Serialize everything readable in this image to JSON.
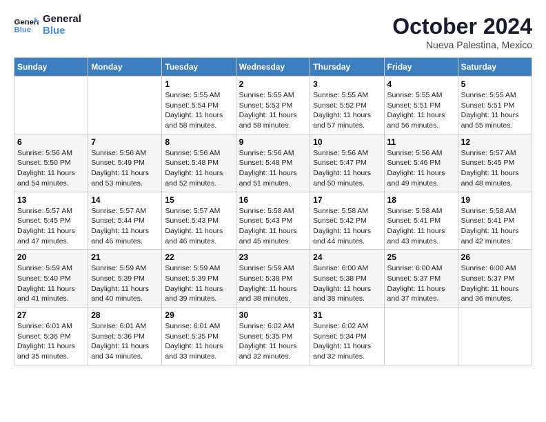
{
  "header": {
    "logo_text_general": "General",
    "logo_text_blue": "Blue",
    "month_title": "October 2024",
    "location": "Nueva Palestina, Mexico"
  },
  "weekdays": [
    "Sunday",
    "Monday",
    "Tuesday",
    "Wednesday",
    "Thursday",
    "Friday",
    "Saturday"
  ],
  "weeks": [
    [
      {
        "day": "",
        "info": ""
      },
      {
        "day": "",
        "info": ""
      },
      {
        "day": "1",
        "info": "Sunrise: 5:55 AM\nSunset: 5:54 PM\nDaylight: 11 hours and 58 minutes."
      },
      {
        "day": "2",
        "info": "Sunrise: 5:55 AM\nSunset: 5:53 PM\nDaylight: 11 hours and 58 minutes."
      },
      {
        "day": "3",
        "info": "Sunrise: 5:55 AM\nSunset: 5:52 PM\nDaylight: 11 hours and 57 minutes."
      },
      {
        "day": "4",
        "info": "Sunrise: 5:55 AM\nSunset: 5:51 PM\nDaylight: 11 hours and 56 minutes."
      },
      {
        "day": "5",
        "info": "Sunrise: 5:55 AM\nSunset: 5:51 PM\nDaylight: 11 hours and 55 minutes."
      }
    ],
    [
      {
        "day": "6",
        "info": "Sunrise: 5:56 AM\nSunset: 5:50 PM\nDaylight: 11 hours and 54 minutes."
      },
      {
        "day": "7",
        "info": "Sunrise: 5:56 AM\nSunset: 5:49 PM\nDaylight: 11 hours and 53 minutes."
      },
      {
        "day": "8",
        "info": "Sunrise: 5:56 AM\nSunset: 5:48 PM\nDaylight: 11 hours and 52 minutes."
      },
      {
        "day": "9",
        "info": "Sunrise: 5:56 AM\nSunset: 5:48 PM\nDaylight: 11 hours and 51 minutes."
      },
      {
        "day": "10",
        "info": "Sunrise: 5:56 AM\nSunset: 5:47 PM\nDaylight: 11 hours and 50 minutes."
      },
      {
        "day": "11",
        "info": "Sunrise: 5:56 AM\nSunset: 5:46 PM\nDaylight: 11 hours and 49 minutes."
      },
      {
        "day": "12",
        "info": "Sunrise: 5:57 AM\nSunset: 5:45 PM\nDaylight: 11 hours and 48 minutes."
      }
    ],
    [
      {
        "day": "13",
        "info": "Sunrise: 5:57 AM\nSunset: 5:45 PM\nDaylight: 11 hours and 47 minutes."
      },
      {
        "day": "14",
        "info": "Sunrise: 5:57 AM\nSunset: 5:44 PM\nDaylight: 11 hours and 46 minutes."
      },
      {
        "day": "15",
        "info": "Sunrise: 5:57 AM\nSunset: 5:43 PM\nDaylight: 11 hours and 46 minutes."
      },
      {
        "day": "16",
        "info": "Sunrise: 5:58 AM\nSunset: 5:43 PM\nDaylight: 11 hours and 45 minutes."
      },
      {
        "day": "17",
        "info": "Sunrise: 5:58 AM\nSunset: 5:42 PM\nDaylight: 11 hours and 44 minutes."
      },
      {
        "day": "18",
        "info": "Sunrise: 5:58 AM\nSunset: 5:41 PM\nDaylight: 11 hours and 43 minutes."
      },
      {
        "day": "19",
        "info": "Sunrise: 5:58 AM\nSunset: 5:41 PM\nDaylight: 11 hours and 42 minutes."
      }
    ],
    [
      {
        "day": "20",
        "info": "Sunrise: 5:59 AM\nSunset: 5:40 PM\nDaylight: 11 hours and 41 minutes."
      },
      {
        "day": "21",
        "info": "Sunrise: 5:59 AM\nSunset: 5:39 PM\nDaylight: 11 hours and 40 minutes."
      },
      {
        "day": "22",
        "info": "Sunrise: 5:59 AM\nSunset: 5:39 PM\nDaylight: 11 hours and 39 minutes."
      },
      {
        "day": "23",
        "info": "Sunrise: 5:59 AM\nSunset: 5:38 PM\nDaylight: 11 hours and 38 minutes."
      },
      {
        "day": "24",
        "info": "Sunrise: 6:00 AM\nSunset: 5:38 PM\nDaylight: 11 hours and 38 minutes."
      },
      {
        "day": "25",
        "info": "Sunrise: 6:00 AM\nSunset: 5:37 PM\nDaylight: 11 hours and 37 minutes."
      },
      {
        "day": "26",
        "info": "Sunrise: 6:00 AM\nSunset: 5:37 PM\nDaylight: 11 hours and 36 minutes."
      }
    ],
    [
      {
        "day": "27",
        "info": "Sunrise: 6:01 AM\nSunset: 5:36 PM\nDaylight: 11 hours and 35 minutes."
      },
      {
        "day": "28",
        "info": "Sunrise: 6:01 AM\nSunset: 5:36 PM\nDaylight: 11 hours and 34 minutes."
      },
      {
        "day": "29",
        "info": "Sunrise: 6:01 AM\nSunset: 5:35 PM\nDaylight: 11 hours and 33 minutes."
      },
      {
        "day": "30",
        "info": "Sunrise: 6:02 AM\nSunset: 5:35 PM\nDaylight: 11 hours and 32 minutes."
      },
      {
        "day": "31",
        "info": "Sunrise: 6:02 AM\nSunset: 5:34 PM\nDaylight: 11 hours and 32 minutes."
      },
      {
        "day": "",
        "info": ""
      },
      {
        "day": "",
        "info": ""
      }
    ]
  ]
}
